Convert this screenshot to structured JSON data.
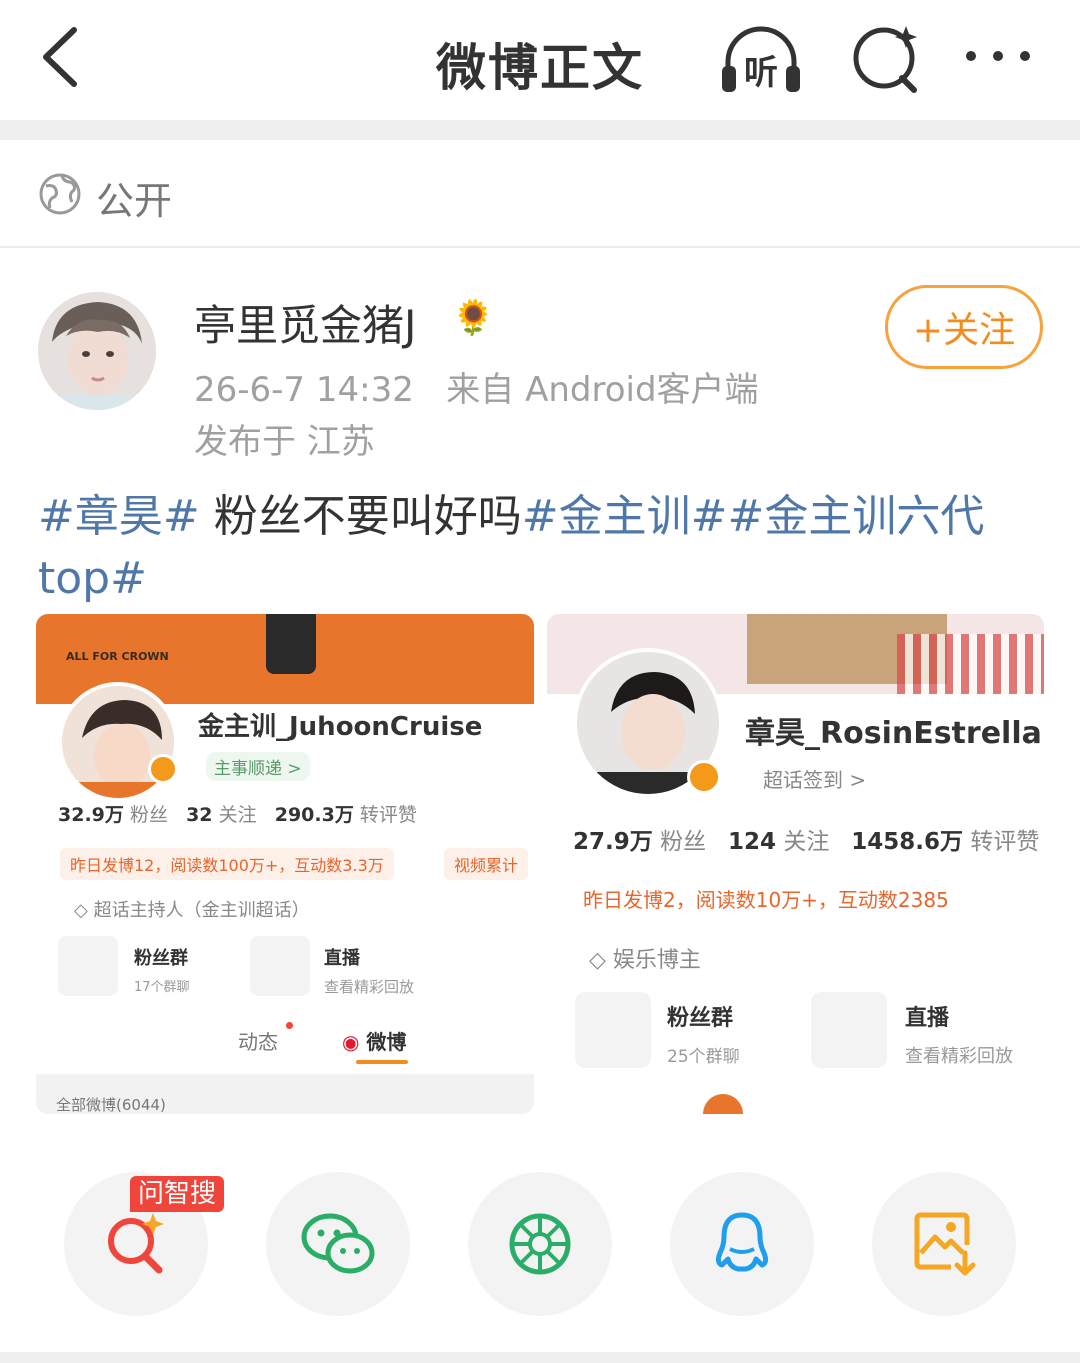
{
  "header": {
    "title": "微博正文",
    "listen_label": "听"
  },
  "visibility": {
    "label": "公开"
  },
  "author": {
    "name": "亭里觅金猪J",
    "emoji": "🌻",
    "time": "26-6-7 14:32",
    "source": "来自 Android客户端",
    "location": "发布于 江苏",
    "follow_label": "+关注"
  },
  "post": {
    "segments": [
      {
        "text": "#章昊#",
        "tag": true
      },
      {
        "text": " 粉丝不要叫好吗",
        "tag": false
      },
      {
        "text": "#金主训##金主训六代top#",
        "tag": true
      }
    ]
  },
  "image1": {
    "watermark": "ALL FOR CROWN",
    "name": "金主训_JuhoonCruise",
    "group_link": "主事顺递 >",
    "stats": {
      "fans_num": "32.9万",
      "fans_label": "粉丝",
      "follow_num": "32",
      "follow_label": "关注",
      "repost_num": "290.3万",
      "repost_label": "转评赞"
    },
    "summary": "昨日发博12，阅读数100万+，互动数3.3万",
    "summary2": "视频累计",
    "role": "超话主持人（金主训超话）",
    "fan_group": {
      "title": "粉丝群",
      "sub": "17个群聊"
    },
    "live": {
      "title": "直播",
      "sub": "查看精彩回放"
    },
    "tabs": {
      "dynamic": "动态",
      "weibo": "微博"
    },
    "all_weibo": "全部微博(6044)"
  },
  "image2": {
    "name": "章昊_RosinEstrella",
    "checkin": "超话签到 >",
    "stats": {
      "fans_num": "27.9万",
      "fans_label": "粉丝",
      "follow_num": "124",
      "follow_label": "关注",
      "repost_num": "1458.6万",
      "repost_label": "转评赞"
    },
    "summary": "昨日发博2，阅读数10万+，互动数2385",
    "role": "娱乐博主",
    "fan_group": {
      "title": "粉丝群",
      "sub": "25个群聊"
    },
    "live": {
      "title": "直播",
      "sub": "查看精彩回放"
    }
  },
  "share": {
    "badge": "问智搜",
    "items": [
      "search-ai",
      "wechat",
      "moments",
      "qq",
      "save-image"
    ]
  },
  "colors": {
    "accent": "#f28c1d",
    "link": "#4f78a8",
    "badge": "#f0453b"
  }
}
